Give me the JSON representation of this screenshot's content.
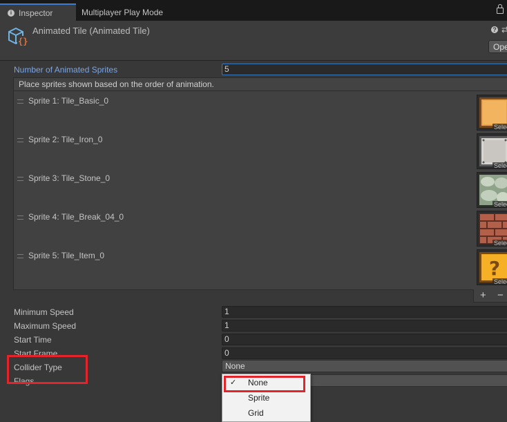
{
  "tabs": [
    {
      "label": "Inspector",
      "active": true
    },
    {
      "label": "Multiplayer Play Mode",
      "active": false
    }
  ],
  "header": {
    "title": "Animated Tile (Animated Tile)",
    "open_button": "Ope",
    "icons": [
      "tile-asset-icon",
      "help-icon",
      "settings-icon",
      "lock-icon"
    ]
  },
  "fields": {
    "num_sprites_label": "Number of Animated Sprites",
    "num_sprites_value": "5",
    "list_hint": "Place sprites shown based on the order of animation.",
    "min_speed_label": "Minimum Speed",
    "min_speed_value": "1",
    "max_speed_label": "Maximum Speed",
    "max_speed_value": "1",
    "start_time_label": "Start Time",
    "start_time_value": "0",
    "start_frame_label": "Start Frame",
    "start_frame_value": "0",
    "collider_type_label": "Collider Type",
    "collider_type_value": "None",
    "flags_label": "Flags"
  },
  "sprites": [
    {
      "label": "Sprite 1: Tile_Basic_0",
      "select": "Select",
      "art": "basic"
    },
    {
      "label": "Sprite 2: Tile_Iron_0",
      "select": "Select",
      "art": "iron"
    },
    {
      "label": "Sprite 3: Tile_Stone_0",
      "select": "Select",
      "art": "stone"
    },
    {
      "label": "Sprite 4: Tile_Break_04_0",
      "select": "Select",
      "art": "brick"
    },
    {
      "label": "Sprite 5: Tile_Item_0",
      "select": "Select",
      "art": "item"
    }
  ],
  "list_controls": {
    "add": "+",
    "remove": "−"
  },
  "collider_menu": {
    "options": [
      "None",
      "Sprite",
      "Grid"
    ],
    "selected": "None",
    "check_glyph": "✓"
  },
  "colors": {
    "accent": "#3c7fd0",
    "annotation": "#e3242b",
    "panel": "#383838"
  }
}
